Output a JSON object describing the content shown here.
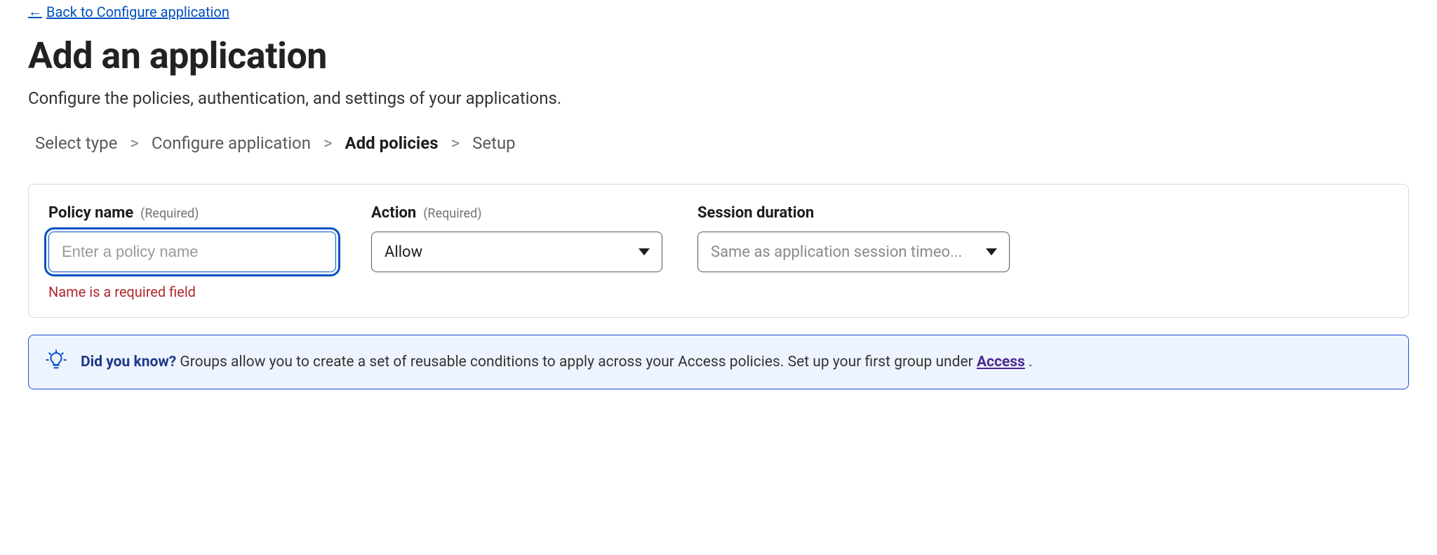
{
  "back_link": {
    "label": "Back to Configure application"
  },
  "page": {
    "title": "Add an application",
    "subtitle": "Configure the policies, authentication, and settings of your applications."
  },
  "breadcrumb": {
    "items": [
      {
        "label": "Select type",
        "active": false
      },
      {
        "label": "Configure application",
        "active": false
      },
      {
        "label": "Add policies",
        "active": true
      },
      {
        "label": "Setup",
        "active": false
      }
    ],
    "separator": ">"
  },
  "form": {
    "policy_name": {
      "label": "Policy name",
      "required_text": "(Required)",
      "placeholder": "Enter a policy name",
      "value": "",
      "error": "Name is a required field"
    },
    "action": {
      "label": "Action",
      "required_text": "(Required)",
      "value": "Allow"
    },
    "session_duration": {
      "label": "Session duration",
      "value": "Same as application session timeo..."
    }
  },
  "info": {
    "strong": "Did you know?",
    "text_before_link": " Groups allow you to create a set of reusable conditions to apply across your Access policies. Set up your first group under ",
    "link": "Access",
    "text_after_link": " ."
  }
}
